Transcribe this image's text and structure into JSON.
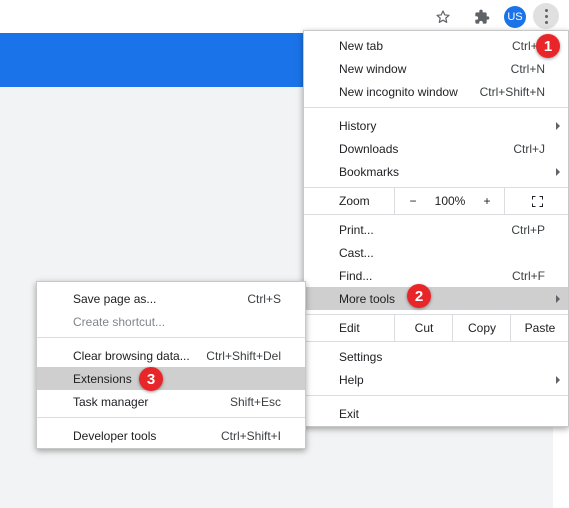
{
  "toolbar": {
    "avatar_text": "US",
    "icons": [
      "star-icon",
      "puzzle-icon",
      "avatar",
      "kebab-icon"
    ]
  },
  "menu": {
    "new_tab": {
      "label": "New tab",
      "shortcut": "Ctrl+T"
    },
    "new_window": {
      "label": "New window",
      "shortcut": "Ctrl+N"
    },
    "new_incognito": {
      "label": "New incognito window",
      "shortcut": "Ctrl+Shift+N"
    },
    "history": {
      "label": "History"
    },
    "downloads": {
      "label": "Downloads",
      "shortcut": "Ctrl+J"
    },
    "bookmarks": {
      "label": "Bookmarks"
    },
    "zoom": {
      "label": "Zoom",
      "minus": "−",
      "value": "100%",
      "plus": "+"
    },
    "print": {
      "label": "Print...",
      "shortcut": "Ctrl+P"
    },
    "cast": {
      "label": "Cast..."
    },
    "find": {
      "label": "Find...",
      "shortcut": "Ctrl+F"
    },
    "more_tools": {
      "label": "More tools"
    },
    "edit": {
      "label": "Edit",
      "cut": "Cut",
      "copy": "Copy",
      "paste": "Paste"
    },
    "settings": {
      "label": "Settings"
    },
    "help": {
      "label": "Help"
    },
    "exit": {
      "label": "Exit"
    }
  },
  "submenu": {
    "save_page": {
      "label": "Save page as...",
      "shortcut": "Ctrl+S"
    },
    "create_shortcut": {
      "label": "Create shortcut..."
    },
    "clear_browsing": {
      "label": "Clear browsing data...",
      "shortcut": "Ctrl+Shift+Del"
    },
    "extensions": {
      "label": "Extensions"
    },
    "task_manager": {
      "label": "Task manager",
      "shortcut": "Shift+Esc"
    },
    "developer_tools": {
      "label": "Developer tools",
      "shortcut": "Ctrl+Shift+I"
    }
  },
  "badges": {
    "one": "1",
    "two": "2",
    "three": "3"
  },
  "colors": {
    "accent": "#1a73e8",
    "badge": "#e8262a",
    "highlight": "#cfcfcf"
  }
}
